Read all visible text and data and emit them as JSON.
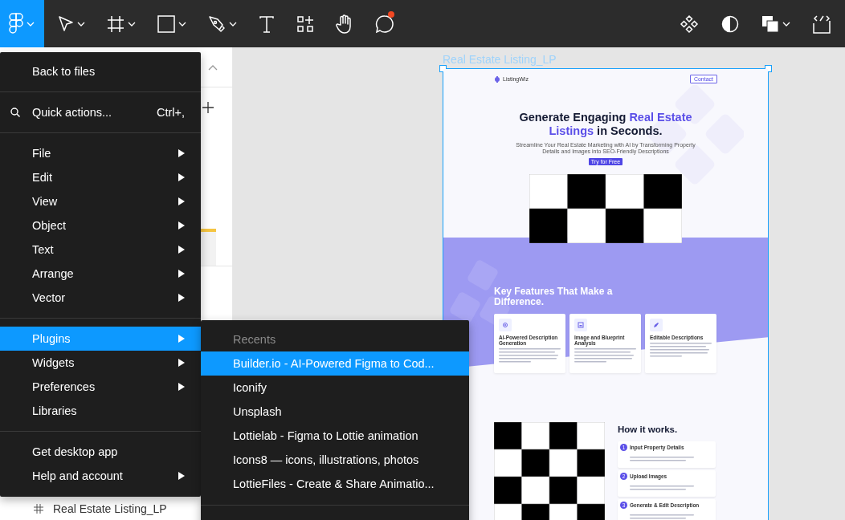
{
  "toolbar": {
    "left_tools": [
      {
        "kind": "figma",
        "selected": true,
        "dropdown": true
      },
      {
        "kind": "move",
        "selected": false,
        "dropdown": true
      },
      {
        "kind": "frame",
        "selected": false,
        "dropdown": true
      },
      {
        "kind": "rectangle",
        "selected": false,
        "dropdown": true
      },
      {
        "kind": "pen",
        "selected": false,
        "dropdown": true
      },
      {
        "kind": "text",
        "selected": false,
        "dropdown": false
      },
      {
        "kind": "resources",
        "selected": false,
        "dropdown": false
      },
      {
        "kind": "hand",
        "selected": false,
        "dropdown": false
      },
      {
        "kind": "comment",
        "selected": false,
        "dropdown": false,
        "notification": true
      }
    ],
    "right_tools": [
      {
        "kind": "components",
        "dropdown": false
      },
      {
        "kind": "contrast",
        "dropdown": false
      },
      {
        "kind": "boolean",
        "dropdown": true
      },
      {
        "kind": "dev-mode",
        "dropdown": false
      }
    ]
  },
  "layers_panel": {
    "layer": "Real Estate Listing_LP"
  },
  "canvas": {
    "frame_title": "Real Estate Listing_LP",
    "frame_selected": true,
    "page": {
      "logo": "ListingWiz",
      "nav_button": "Contact",
      "headline": [
        {
          "text": "Generate Engaging ",
          "accent": false
        },
        {
          "text": "Real Estate Listings",
          "accent": true
        },
        {
          "text": " in Seconds.",
          "accent": false
        }
      ],
      "subtitle": "Streamline Your Real Estate Marketing with AI by Transforming Property Details and Images into SEO-Friendly Descriptions",
      "cta": "Try for Free",
      "features_title": "Key Features That Make a Difference.",
      "features": [
        {
          "title": "AI-Powered Description Generation"
        },
        {
          "title": "Image and Blueprint Analysis"
        },
        {
          "title": "Editable Descriptions"
        }
      ],
      "how_title": "How it works.",
      "steps": [
        {
          "number": "1",
          "title": "Input Property Details"
        },
        {
          "number": "2",
          "title": "Upload Images"
        },
        {
          "number": "3",
          "title": "Generate & Edit Description"
        }
      ]
    }
  },
  "main_menu": [
    {
      "kind": "item",
      "label": "Back to files",
      "selected": false,
      "submenu": false
    },
    {
      "kind": "divider"
    },
    {
      "kind": "search",
      "label": "Quick actions...",
      "shortcut": "Ctrl+,",
      "selected": false,
      "submenu": false
    },
    {
      "kind": "divider"
    },
    {
      "kind": "item",
      "label": "File",
      "selected": false,
      "submenu": true
    },
    {
      "kind": "item",
      "label": "Edit",
      "selected": false,
      "submenu": true
    },
    {
      "kind": "item",
      "label": "View",
      "selected": false,
      "submenu": true
    },
    {
      "kind": "item",
      "label": "Object",
      "selected": false,
      "submenu": true
    },
    {
      "kind": "item",
      "label": "Text",
      "selected": false,
      "submenu": true
    },
    {
      "kind": "item",
      "label": "Arrange",
      "selected": false,
      "submenu": true
    },
    {
      "kind": "item",
      "label": "Vector",
      "selected": false,
      "submenu": true
    },
    {
      "kind": "divider"
    },
    {
      "kind": "item",
      "label": "Plugins",
      "selected": true,
      "submenu": true
    },
    {
      "kind": "item",
      "label": "Widgets",
      "selected": false,
      "submenu": true
    },
    {
      "kind": "item",
      "label": "Preferences",
      "selected": false,
      "submenu": true
    },
    {
      "kind": "item",
      "label": "Libraries",
      "selected": false,
      "submenu": false
    },
    {
      "kind": "divider"
    },
    {
      "kind": "item",
      "label": "Get desktop app",
      "selected": false,
      "submenu": false
    },
    {
      "kind": "item",
      "label": "Help and account",
      "selected": false,
      "submenu": true
    }
  ],
  "plugins_submenu": {
    "header": "Recents",
    "items": [
      {
        "label": "Builder.io - AI-Powered Figma to Cod...",
        "selected": true
      },
      {
        "label": "Iconify",
        "selected": false
      },
      {
        "label": "Unsplash",
        "selected": false
      },
      {
        "label": "Lottielab - Figma to Lottie animation",
        "selected": false
      },
      {
        "label": "Icons8 — icons, illustrations, photos",
        "selected": false
      },
      {
        "label": "LottieFiles - Create & Share Animatio...",
        "selected": false
      }
    ]
  }
}
